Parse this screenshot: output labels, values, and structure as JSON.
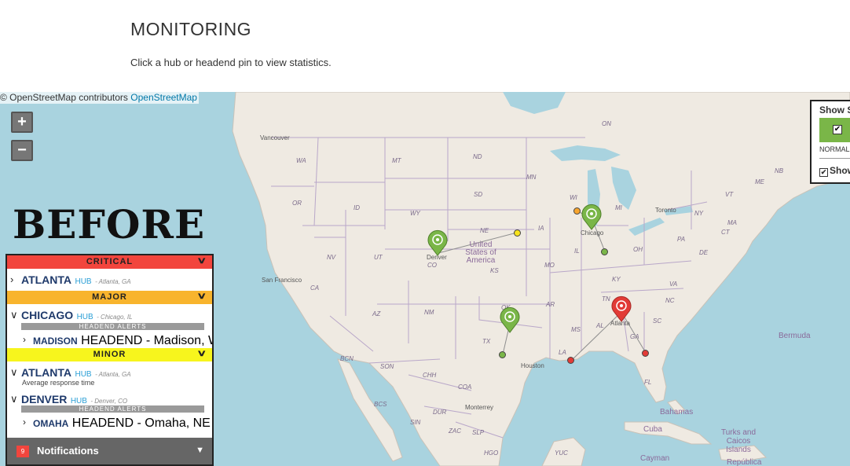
{
  "header": {
    "title": "MONITORING",
    "subtitle": "Click a hub or headend pin to view statistics."
  },
  "map": {
    "attribution_text": "© OpenStreetMap contributors",
    "attribution_link": "OpenStreetMap",
    "zoom_in": "+",
    "zoom_out": "−",
    "water_color": "#a9d3df",
    "land_color": "#efeae2",
    "labels": {
      "on": "ON",
      "vancouver": "Vancouver",
      "wa": "WA",
      "mt": "MT",
      "nd": "ND",
      "mn": "MN",
      "or": "OR",
      "id": "ID",
      "wy": "WY",
      "sd": "SD",
      "wi": "WI",
      "mi": "MI",
      "toronto": "Toronto",
      "ny": "NY",
      "nb": "NB",
      "ne": "NE",
      "ia": "IA",
      "united_states": "United States of America",
      "nv": "NV",
      "ut": "UT",
      "co": "CO",
      "ks": "KS",
      "il": "IL",
      "oh": "OH",
      "pa": "PA",
      "ca": "CA",
      "san_francisco": "San Francisco",
      "mo": "MO",
      "ky": "KY",
      "va": "VA",
      "az": "AZ",
      "nm": "NM",
      "ok": "OK",
      "ar": "AR",
      "tn": "TN",
      "nc": "NC",
      "sc": "SC",
      "ms": "MS",
      "al": "AL",
      "ga": "GA",
      "tx": "TX",
      "la": "LA",
      "fl": "FL",
      "houston": "Houston",
      "bcn": "BCN",
      "son": "SON",
      "chh": "CHH",
      "coa": "COA",
      "bcs": "BCS",
      "dur": "DUR",
      "sin": "SIN",
      "monterrey": "Monterrey",
      "zac": "ZAC",
      "slp": "SLP",
      "hgo": "HGO",
      "yuc": "YUC",
      "bahamas": "Bahamas",
      "cuba": "Cuba",
      "turks": "Turks and Caicos Islands",
      "cayman": "Cayman",
      "republica": "República",
      "bermuda": "Bermuda",
      "vt": "VT",
      "me": "ME",
      "ma": "MA",
      "ct": "CT",
      "de": "DE",
      "denver": "Denver",
      "chicago": "Chicago",
      "atlanta": "Atlanta"
    },
    "pins": [
      {
        "id": "denver",
        "status": "normal",
        "color": "#7ab648"
      },
      {
        "id": "chicago",
        "status": "normal",
        "color": "#7ab648"
      },
      {
        "id": "dallas",
        "status": "normal",
        "color": "#7ab648"
      },
      {
        "id": "atlanta",
        "status": "critical",
        "color": "#e23b36"
      }
    ],
    "status_colors": {
      "critical": "#e23b36",
      "major": "#f8b42d",
      "minor": "#f7f51d",
      "normal": "#7ab648"
    }
  },
  "overlay_label": "BEFORE",
  "status_panel": {
    "critical": {
      "label": "CRITICAL",
      "items": [
        {
          "name": "ATLANTA",
          "type": "HUB",
          "location": "- Atlanta, GA"
        }
      ]
    },
    "major": {
      "label": "MAJOR",
      "items": [
        {
          "name": "CHICAGO",
          "type": "HUB",
          "location": "- Chicago, IL"
        }
      ],
      "alerts_label": "HEADEND ALERTS",
      "sub_items": [
        {
          "name": "MADISON",
          "type": "HEADEND",
          "location": "- Madison, WI"
        }
      ]
    },
    "minor": {
      "label": "MINOR",
      "items": [
        {
          "name": "ATLANTA",
          "type": "HUB",
          "location": "- Atlanta, GA",
          "note": "Average response time"
        },
        {
          "name": "DENVER",
          "type": "HUB",
          "location": "- Denver, CO"
        }
      ],
      "alerts_label": "HEADEND ALERTS",
      "sub_items": [
        {
          "name": "OMAHA",
          "type": "HEADEND",
          "location": "- Omaha, NE"
        }
      ]
    },
    "notifications": {
      "count": "9",
      "label": "Notifications"
    }
  },
  "legend": {
    "title": "Show S",
    "normal_label": "NORMAL",
    "show2_label": "Show"
  }
}
